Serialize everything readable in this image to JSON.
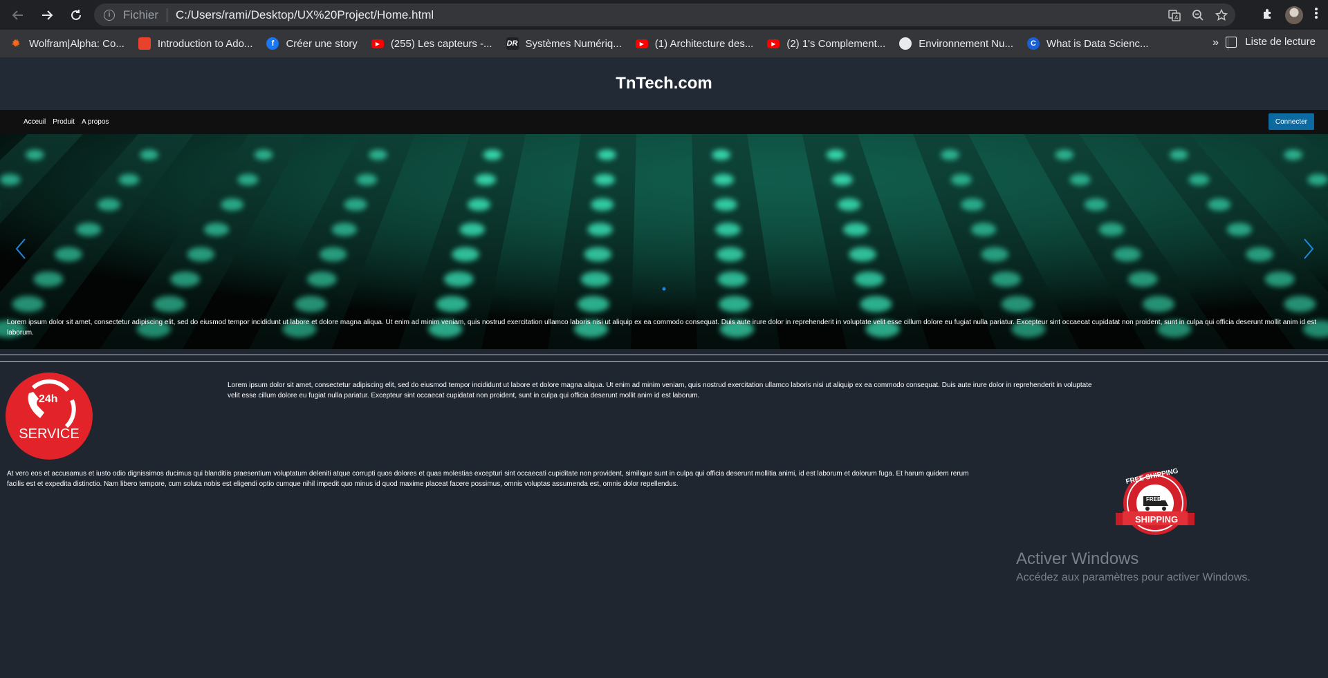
{
  "browser": {
    "url_scheme_label": "Fichier",
    "url": "C:/Users/rami/Desktop/UX%20Project/Home.html",
    "bookmarks": [
      {
        "label": "Wolfram|Alpha: Co...",
        "icon": "wolfram-icon",
        "color": "#f26b22"
      },
      {
        "label": "Introduction to Ado...",
        "icon": "adobe-icon",
        "color": "#e8412c"
      },
      {
        "label": "Créer une story",
        "icon": "facebook-icon",
        "color": "#1877f2"
      },
      {
        "label": "(255) Les capteurs -...",
        "icon": "youtube-icon",
        "color": "#ff0000"
      },
      {
        "label": "Systèmes Numériq...",
        "icon": "dr-icon",
        "color": "#ffffff"
      },
      {
        "label": "(1) Architecture des...",
        "icon": "youtube-icon",
        "color": "#ff0000"
      },
      {
        "label": "(2) 1's Complement...",
        "icon": "youtube-icon",
        "color": "#ff0000"
      },
      {
        "label": "Environnement Nu...",
        "icon": "globe-icon",
        "color": "#e8eaed"
      },
      {
        "label": "What is Data Scienc...",
        "icon": "c-icon",
        "color": "#1a5fd6"
      }
    ],
    "overflow": "»",
    "reading_list": "Liste de lecture"
  },
  "site": {
    "title": "TnTech.com",
    "nav": [
      "Acceuil",
      "Produit",
      "A propos"
    ],
    "connect_label": "Connecter"
  },
  "content": {
    "paragraph1": "Lorem ipsum dolor sit amet, consectetur adipiscing elit, sed do eiusmod tempor incididunt ut labore et dolore magna aliqua. Ut enim ad minim veniam, quis nostrud exercitation ullamco laboris nisi ut aliquip ex ea commodo consequat. Duis aute irure dolor in reprehenderit in voluptate velit esse cillum dolore eu fugiat nulla pariatur. Excepteur sint occaecat cupidatat non proident, sunt in culpa qui officia deserunt mollit anim id est laborum.",
    "paragraph2": "Lorem ipsum dolor sit amet, consectetur adipiscing elit, sed do eiusmod tempor incididunt ut labore et dolore magna aliqua. Ut enim ad minim veniam, quis nostrud exercitation ullamco laboris nisi ut aliquip ex ea commodo consequat. Duis aute irure dolor in reprehenderit in voluptate velit esse cillum dolore eu fugiat nulla pariatur. Excepteur sint occaecat cupidatat non proident, sunt in culpa qui officia deserunt mollit anim id est laborum.",
    "paragraph3": "At vero eos et accusamus et iusto odio dignissimos ducimus qui blanditiis praesentium voluptatum deleniti atque corrupti quos dolores et quas molestias excepturi sint occaecati cupiditate non provident, similique sunt in culpa qui officia deserunt mollitia animi, id est laborum et dolorum fuga. Et harum quidem rerum facilis est et expedita distinctio. Nam libero tempore, cum soluta nobis est eligendi optio cumque nihil impedit quo minus id quod maxime placeat facere possimus, omnis voluptas assumenda est, omnis dolor repellendus.",
    "service_badge_label": "SERVICE",
    "service_badge_hours": "24h",
    "shipping_badge_top": "FREE SHIPPING",
    "shipping_badge_truck": "FREE",
    "shipping_badge_ribbon": "SHIPPING"
  },
  "watermark": {
    "title": "Activer Windows",
    "subtitle": "Accédez aux paramètres pour activer Windows."
  },
  "colors": {
    "page_bg": "#1f2630",
    "accent_button": "#0d6aa0",
    "carousel_arrow": "#1e88e5",
    "service_red": "#e3232a"
  }
}
